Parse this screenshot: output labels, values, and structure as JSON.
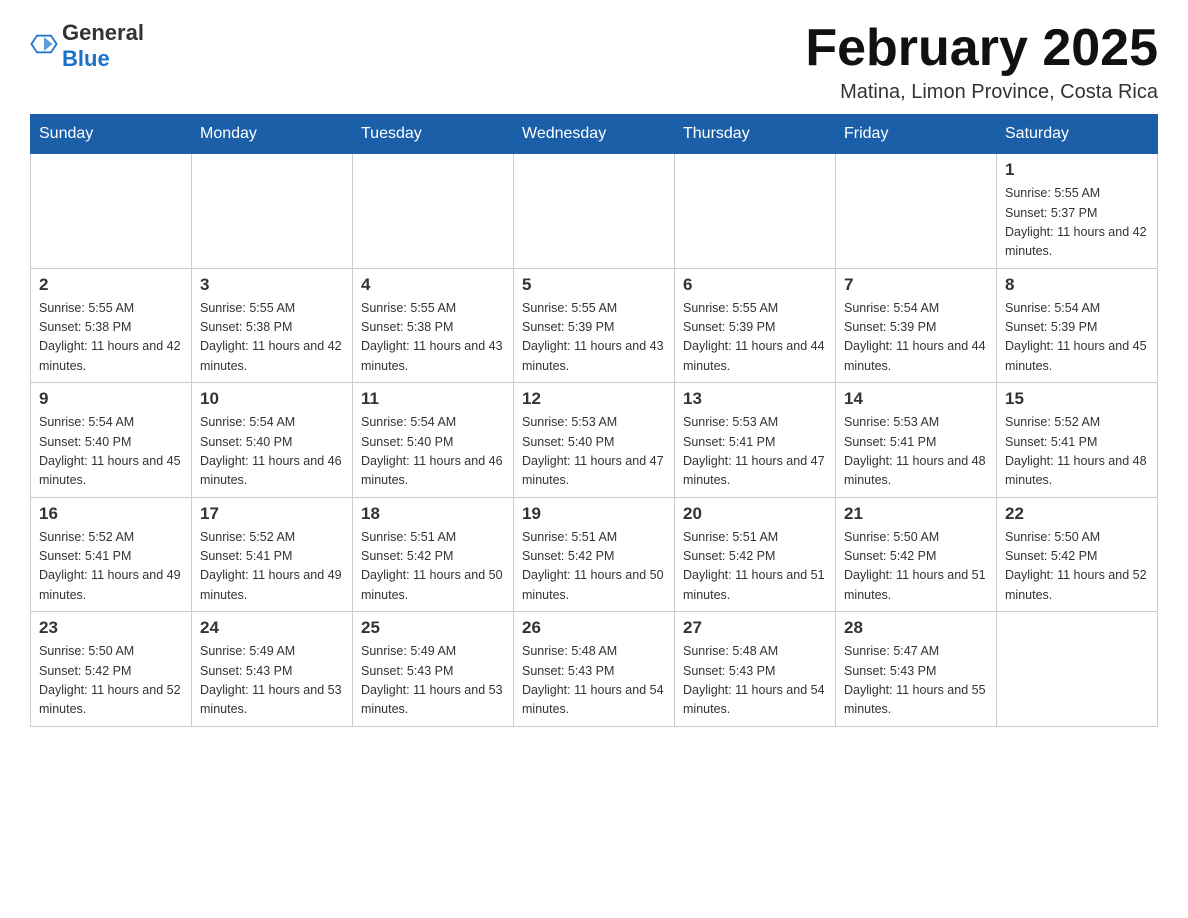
{
  "header": {
    "logo_general": "General",
    "logo_blue": "Blue",
    "month_title": "February 2025",
    "location": "Matina, Limon Province, Costa Rica"
  },
  "days_of_week": [
    "Sunday",
    "Monday",
    "Tuesday",
    "Wednesday",
    "Thursday",
    "Friday",
    "Saturday"
  ],
  "weeks": [
    [
      {
        "day": "",
        "info": ""
      },
      {
        "day": "",
        "info": ""
      },
      {
        "day": "",
        "info": ""
      },
      {
        "day": "",
        "info": ""
      },
      {
        "day": "",
        "info": ""
      },
      {
        "day": "",
        "info": ""
      },
      {
        "day": "1",
        "info": "Sunrise: 5:55 AM\nSunset: 5:37 PM\nDaylight: 11 hours and 42 minutes."
      }
    ],
    [
      {
        "day": "2",
        "info": "Sunrise: 5:55 AM\nSunset: 5:38 PM\nDaylight: 11 hours and 42 minutes."
      },
      {
        "day": "3",
        "info": "Sunrise: 5:55 AM\nSunset: 5:38 PM\nDaylight: 11 hours and 42 minutes."
      },
      {
        "day": "4",
        "info": "Sunrise: 5:55 AM\nSunset: 5:38 PM\nDaylight: 11 hours and 43 minutes."
      },
      {
        "day": "5",
        "info": "Sunrise: 5:55 AM\nSunset: 5:39 PM\nDaylight: 11 hours and 43 minutes."
      },
      {
        "day": "6",
        "info": "Sunrise: 5:55 AM\nSunset: 5:39 PM\nDaylight: 11 hours and 44 minutes."
      },
      {
        "day": "7",
        "info": "Sunrise: 5:54 AM\nSunset: 5:39 PM\nDaylight: 11 hours and 44 minutes."
      },
      {
        "day": "8",
        "info": "Sunrise: 5:54 AM\nSunset: 5:39 PM\nDaylight: 11 hours and 45 minutes."
      }
    ],
    [
      {
        "day": "9",
        "info": "Sunrise: 5:54 AM\nSunset: 5:40 PM\nDaylight: 11 hours and 45 minutes."
      },
      {
        "day": "10",
        "info": "Sunrise: 5:54 AM\nSunset: 5:40 PM\nDaylight: 11 hours and 46 minutes."
      },
      {
        "day": "11",
        "info": "Sunrise: 5:54 AM\nSunset: 5:40 PM\nDaylight: 11 hours and 46 minutes."
      },
      {
        "day": "12",
        "info": "Sunrise: 5:53 AM\nSunset: 5:40 PM\nDaylight: 11 hours and 47 minutes."
      },
      {
        "day": "13",
        "info": "Sunrise: 5:53 AM\nSunset: 5:41 PM\nDaylight: 11 hours and 47 minutes."
      },
      {
        "day": "14",
        "info": "Sunrise: 5:53 AM\nSunset: 5:41 PM\nDaylight: 11 hours and 48 minutes."
      },
      {
        "day": "15",
        "info": "Sunrise: 5:52 AM\nSunset: 5:41 PM\nDaylight: 11 hours and 48 minutes."
      }
    ],
    [
      {
        "day": "16",
        "info": "Sunrise: 5:52 AM\nSunset: 5:41 PM\nDaylight: 11 hours and 49 minutes."
      },
      {
        "day": "17",
        "info": "Sunrise: 5:52 AM\nSunset: 5:41 PM\nDaylight: 11 hours and 49 minutes."
      },
      {
        "day": "18",
        "info": "Sunrise: 5:51 AM\nSunset: 5:42 PM\nDaylight: 11 hours and 50 minutes."
      },
      {
        "day": "19",
        "info": "Sunrise: 5:51 AM\nSunset: 5:42 PM\nDaylight: 11 hours and 50 minutes."
      },
      {
        "day": "20",
        "info": "Sunrise: 5:51 AM\nSunset: 5:42 PM\nDaylight: 11 hours and 51 minutes."
      },
      {
        "day": "21",
        "info": "Sunrise: 5:50 AM\nSunset: 5:42 PM\nDaylight: 11 hours and 51 minutes."
      },
      {
        "day": "22",
        "info": "Sunrise: 5:50 AM\nSunset: 5:42 PM\nDaylight: 11 hours and 52 minutes."
      }
    ],
    [
      {
        "day": "23",
        "info": "Sunrise: 5:50 AM\nSunset: 5:42 PM\nDaylight: 11 hours and 52 minutes."
      },
      {
        "day": "24",
        "info": "Sunrise: 5:49 AM\nSunset: 5:43 PM\nDaylight: 11 hours and 53 minutes."
      },
      {
        "day": "25",
        "info": "Sunrise: 5:49 AM\nSunset: 5:43 PM\nDaylight: 11 hours and 53 minutes."
      },
      {
        "day": "26",
        "info": "Sunrise: 5:48 AM\nSunset: 5:43 PM\nDaylight: 11 hours and 54 minutes."
      },
      {
        "day": "27",
        "info": "Sunrise: 5:48 AM\nSunset: 5:43 PM\nDaylight: 11 hours and 54 minutes."
      },
      {
        "day": "28",
        "info": "Sunrise: 5:47 AM\nSunset: 5:43 PM\nDaylight: 11 hours and 55 minutes."
      },
      {
        "day": "",
        "info": ""
      }
    ]
  ]
}
